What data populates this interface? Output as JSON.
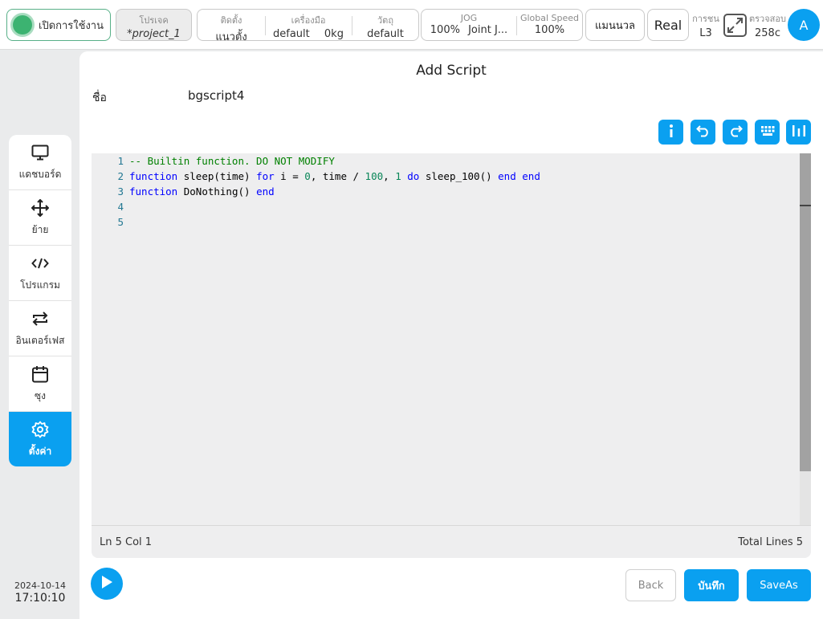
{
  "topbar": {
    "power_label": "เปิดการใช้งาน",
    "project": {
      "title": "โปรเจค",
      "value": "*project_1"
    },
    "install": {
      "mount": {
        "title": "ติดตั้ง",
        "value": "แนวตั้ง"
      },
      "tool": {
        "title": "เครื่องมือ",
        "value": "default",
        "weight": "0kg"
      },
      "payload": {
        "title": "วัตถุ",
        "value": "default"
      }
    },
    "jog": {
      "title": "JOG",
      "percent": "100%",
      "mode": "Joint J..."
    },
    "global_speed": {
      "title": "Global Speed",
      "value": "100%"
    },
    "mode_label": "แมนนวล",
    "real_label": "Real",
    "collision": {
      "title": "การชน",
      "value": "L3"
    },
    "check": {
      "title": "ตรวจสอบ",
      "value": "258c"
    },
    "avatar_letter": "A"
  },
  "sidebar": {
    "items": [
      {
        "label": "แดชบอร์ด",
        "icon": "monitor-icon"
      },
      {
        "label": "ย้าย",
        "icon": "move-icon"
      },
      {
        "label": "โปรแกรม",
        "icon": "code-icon"
      },
      {
        "label": "อินเตอร์เฟส",
        "icon": "swap-icon"
      },
      {
        "label": "ซุง",
        "icon": "calendar-icon"
      },
      {
        "label": "ตั้งค่า",
        "icon": "gear-icon",
        "active": true
      }
    ],
    "date": "2024-10-14",
    "time": "17:10:10"
  },
  "main": {
    "title": "Add Script",
    "name_label": "ชื่อ",
    "name_value": "bgscript4",
    "toolbar_icons": [
      "info-icon",
      "undo-icon",
      "redo-icon",
      "keyboard-icon",
      "format-icon"
    ],
    "editor": {
      "line_numbers": [
        "1",
        "2",
        "3",
        "4",
        "5"
      ],
      "lines": {
        "l1": "-- Builtin function. DO NOT MODIFY",
        "l2": {
          "a": "function",
          "b": " sleep(time) ",
          "c": "for",
          "d": " i = ",
          "e": "0",
          "f": ", time / ",
          "g": "100",
          "h": ", ",
          "i": "1",
          "j": " ",
          "k": "do",
          "l": " sleep_100() ",
          "m": "end",
          "n": " ",
          "o": "end"
        },
        "l3": {
          "a": "function",
          "b": " DoNothing() ",
          "c": "end"
        }
      },
      "status_left": "Ln 5 Col 1",
      "status_right": "Total Lines 5"
    },
    "buttons": {
      "back": "Back",
      "save": "บันทึก",
      "saveas": "SaveAs"
    }
  },
  "colors": {
    "accent": "#0aa0f0",
    "power_led": "#3cb371",
    "keyword": "#0000ff",
    "comment": "#008000",
    "number": "#098658",
    "line_number": "#237893"
  }
}
